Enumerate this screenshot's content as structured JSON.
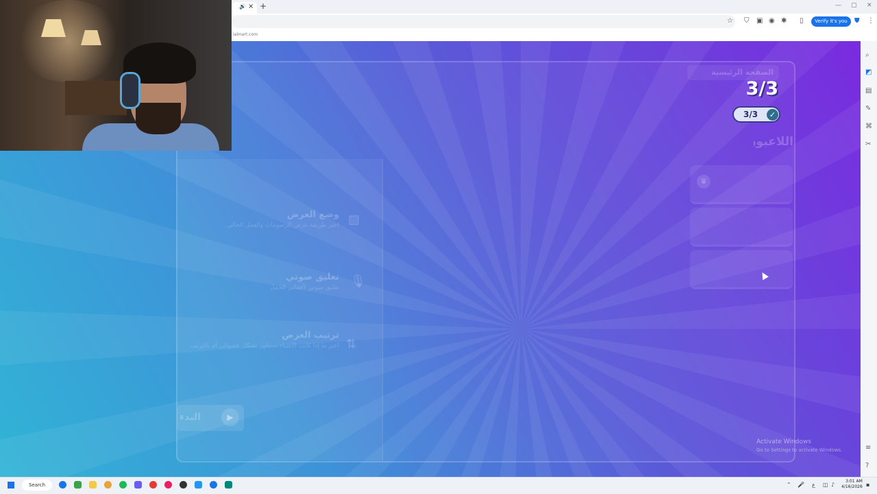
{
  "browser": {
    "bookmark_url": "ialmart.com",
    "verify_label": "Verify it's you",
    "new_tab": "+",
    "tab_close": "×"
  },
  "game": {
    "home_label": "الصفحة الرئيسية",
    "score": "3/3",
    "pill": "3/3",
    "players_title": "اللاعبون",
    "options": [
      {
        "title": "وضع العرض",
        "desc": "اختر طريقة عرض الرسومات والعمل الحالي",
        "icon": "image-icon"
      },
      {
        "title": "تعليق صوتي",
        "desc": "تعليق صوتي لأفعالي الحمل",
        "icon": "microphone-icon"
      },
      {
        "title": "ترتيب العرض",
        "desc": "اختر ما إذا كانت الأشياء ستظهر بشكل عشوائي أم بالترتيب",
        "icon": "sort-arrows-icon"
      }
    ],
    "play_label": "البدء"
  },
  "windows": {
    "activate_title": "Activate Windows",
    "activate_sub": "Go to Settings to activate Windows.",
    "search_label": "Search",
    "time": "3:01 AM",
    "date": "4/16/2026"
  }
}
